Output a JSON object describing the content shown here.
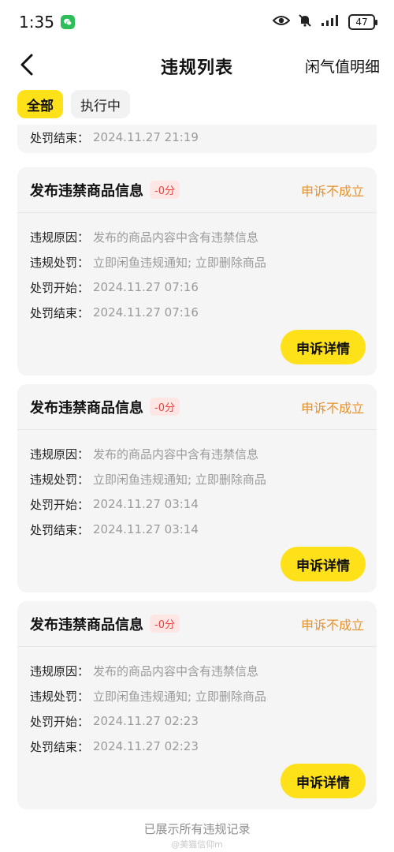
{
  "status_bar": {
    "time": "1:35",
    "battery": "47"
  },
  "nav": {
    "title": "违规列表",
    "right_link": "闲气值明细"
  },
  "filters": [
    {
      "label": "全部"
    },
    {
      "label": "执行中"
    }
  ],
  "partial_card": {
    "label": "处罚结束：",
    "value": "2024.11.27 21:19"
  },
  "cards": [
    {
      "title": "发布违禁商品信息",
      "score": "-0分",
      "status": "申诉不成立",
      "rows": [
        {
          "label": "违规原因：",
          "value": "发布的商品内容中含有违禁信息"
        },
        {
          "label": "违规处罚：",
          "value": "立即闲鱼违规通知; 立即删除商品"
        },
        {
          "label": "处罚开始：",
          "value": "2024.11.27 07:16"
        },
        {
          "label": "处罚结束：",
          "value": "2024.11.27 07:16"
        }
      ],
      "button": "申诉详情"
    },
    {
      "title": "发布违禁商品信息",
      "score": "-0分",
      "status": "申诉不成立",
      "rows": [
        {
          "label": "违规原因：",
          "value": "发布的商品内容中含有违禁信息"
        },
        {
          "label": "违规处罚：",
          "value": "立即闲鱼违规通知; 立即删除商品"
        },
        {
          "label": "处罚开始：",
          "value": "2024.11.27 03:14"
        },
        {
          "label": "处罚结束：",
          "value": "2024.11.27 03:14"
        }
      ],
      "button": "申诉详情"
    },
    {
      "title": "发布违禁商品信息",
      "score": "-0分",
      "status": "申诉不成立",
      "rows": [
        {
          "label": "违规原因：",
          "value": "发布的商品内容中含有违禁信息"
        },
        {
          "label": "违规处罚：",
          "value": "立即闲鱼违规通知; 立即删除商品"
        },
        {
          "label": "处罚开始：",
          "value": "2024.11.27 02:23"
        },
        {
          "label": "处罚结束：",
          "value": "2024.11.27 02:23"
        }
      ],
      "button": "申诉详情"
    }
  ],
  "footer": {
    "text": "已展示所有违规记录",
    "watermark": "@美猫信仰m"
  },
  "colors": {
    "accent": "#ffe11a",
    "status": "#e6922a",
    "score": "#e6453f"
  }
}
